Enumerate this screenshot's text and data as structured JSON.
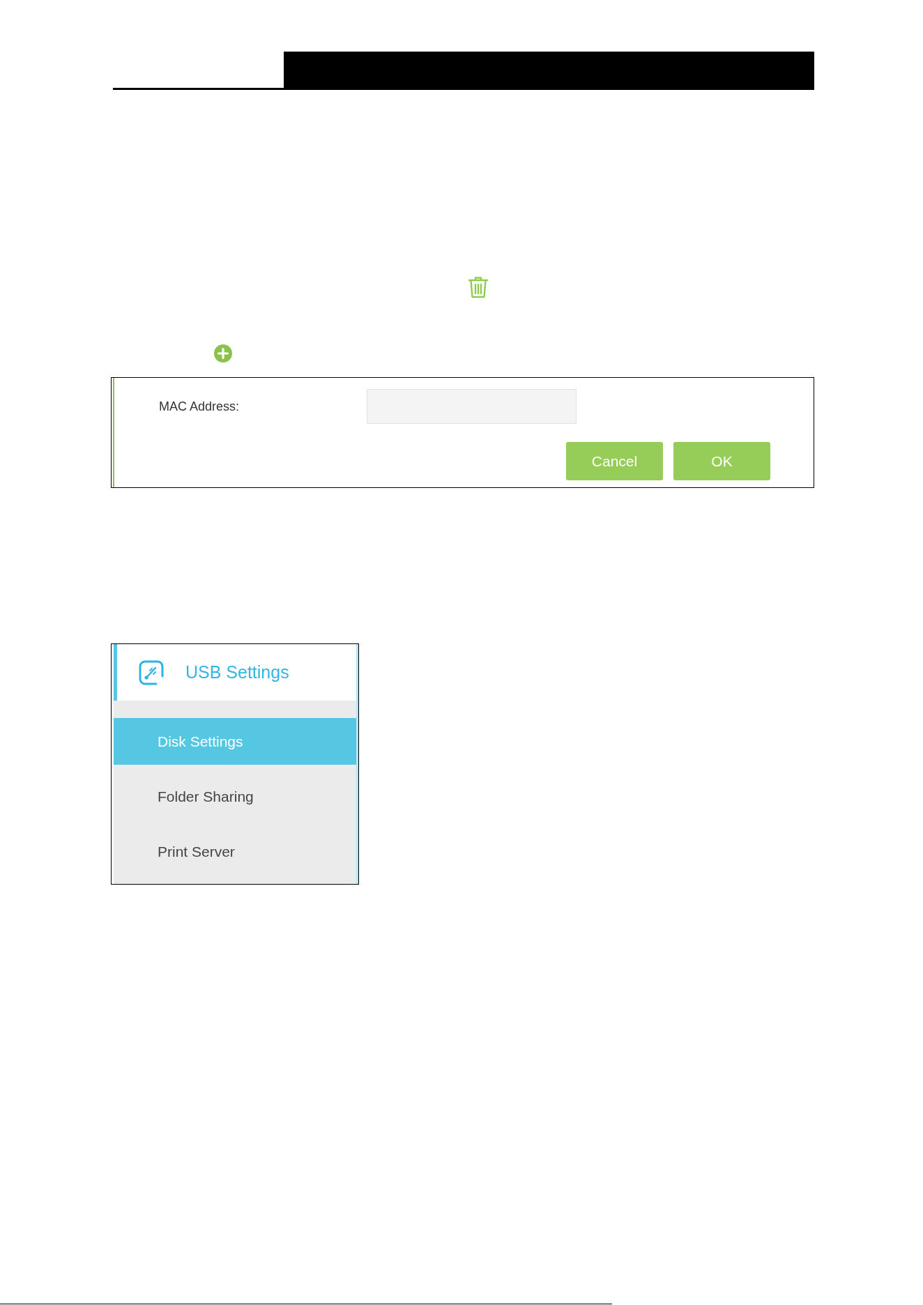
{
  "mac_form": {
    "label": "MAC Address:",
    "buttons": [
      "Cancel",
      "OK"
    ]
  },
  "usb_menu": {
    "title": "USB Settings",
    "items": [
      {
        "label": "Disk Settings",
        "selected": true
      },
      {
        "label": "Folder Sharing",
        "selected": false
      },
      {
        "label": "Print Server",
        "selected": false
      }
    ]
  }
}
